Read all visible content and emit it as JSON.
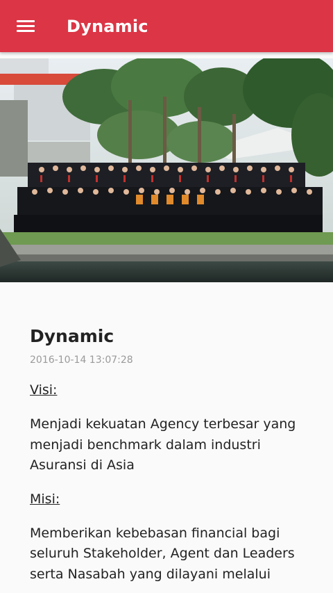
{
  "appbar": {
    "title": "Dynamic",
    "menu_icon": "hamburger-menu-icon",
    "color": "#dc3545"
  },
  "hero": {
    "image": "group-photo"
  },
  "post": {
    "title": "Dynamic",
    "date": "2016-10-14 13:07:28",
    "visi_label": "Visi:",
    "visi_text": "Menjadi kekuatan Agency terbesar yang menjadi benchmark dalam industri Asuransi di Asia",
    "misi_label": "Misi:",
    "misi_text": "Memberikan kebebasan financial bagi seluruh Stakeholder, Agent dan Leaders serta Nasabah yang dilayani melalui"
  }
}
